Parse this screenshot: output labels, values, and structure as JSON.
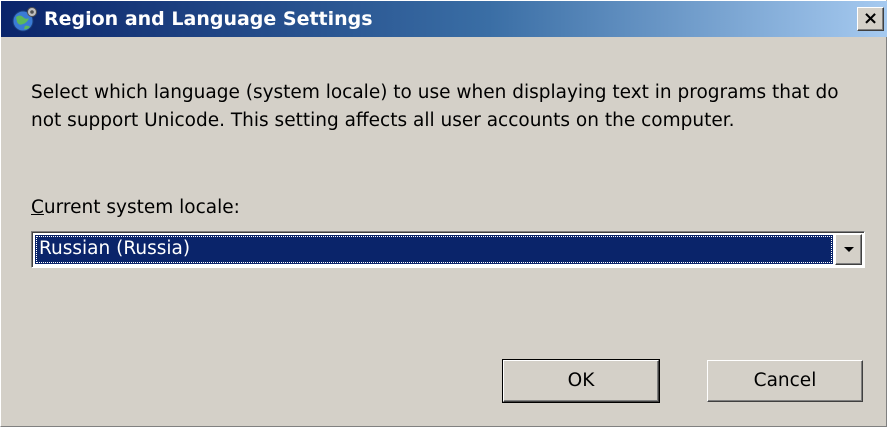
{
  "window": {
    "title": "Region and Language Settings",
    "close_label": "×",
    "icon": "globe-settings-icon"
  },
  "content": {
    "description": "Select which language (system locale) to use when displaying text in programs that do not support Unicode. This setting affects all user accounts on the computer.",
    "locale_label_accel": "C",
    "locale_label_rest": "urrent system locale:",
    "locale_value": "Russian (Russia)"
  },
  "buttons": {
    "ok_label": "OK",
    "cancel_label": "Cancel"
  },
  "colors": {
    "titlebar_start": "#0a246a",
    "titlebar_end": "#a6caf0",
    "selection": "#0a246a",
    "dialog_bg": "#d4d0c8"
  }
}
